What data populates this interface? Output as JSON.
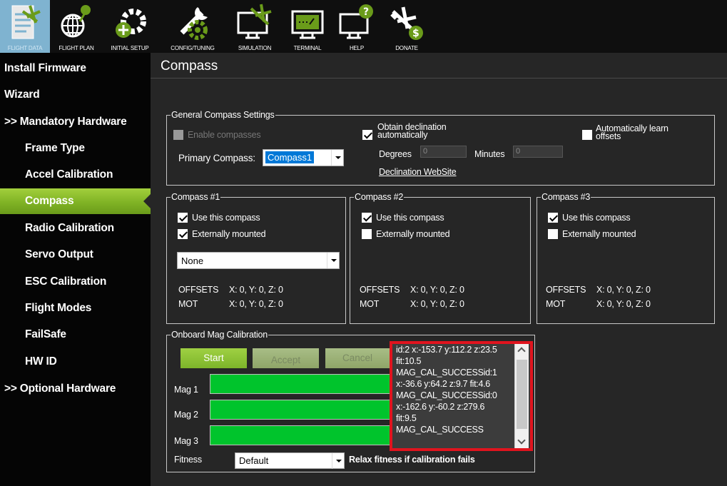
{
  "toolbar": {
    "items": [
      {
        "label": "FLIGHT DATA",
        "icon": "flight-data-icon"
      },
      {
        "label": "FLIGHT PLAN",
        "icon": "flight-plan-icon"
      },
      {
        "label": "INITIAL SETUP",
        "icon": "initial-setup-icon"
      },
      {
        "label": "CONFIG/TUNING",
        "icon": "config-tuning-icon"
      },
      {
        "label": "SIMULATION",
        "icon": "simulation-icon"
      },
      {
        "label": "TERMINAL",
        "icon": "terminal-icon"
      },
      {
        "label": "HELP",
        "icon": "help-icon"
      },
      {
        "label": "DONATE",
        "icon": "donate-icon"
      }
    ]
  },
  "sidebar": {
    "items": [
      {
        "label": "Install Firmware"
      },
      {
        "label": "Wizard"
      },
      {
        "label": ">> Mandatory Hardware"
      },
      {
        "label": "Frame Type"
      },
      {
        "label": "Accel Calibration"
      },
      {
        "label": "Compass"
      },
      {
        "label": "Radio Calibration"
      },
      {
        "label": "Servo Output"
      },
      {
        "label": "ESC Calibration"
      },
      {
        "label": "Flight Modes"
      },
      {
        "label": "FailSafe"
      },
      {
        "label": "HW ID"
      },
      {
        "label": ">> Optional Hardware"
      }
    ]
  },
  "main": {
    "title": "Compass",
    "general": {
      "legend": "General Compass Settings",
      "enable_label": "Enable compasses",
      "primary_label": "Primary Compass:",
      "primary_value": "Compass1",
      "declination_label": "Obtain declination automatically",
      "degrees_label": "Degrees",
      "degrees_value": "0",
      "minutes_label": "Minutes",
      "minutes_value": "0",
      "website_link": "Declination WebSite",
      "learn_label": "Automatically learn offsets"
    },
    "compasses": [
      {
        "legend": "Compass #1",
        "use_label": "Use this compass",
        "ext_label": "Externally mounted",
        "orientation": "None",
        "offsets_label": "OFFSETS",
        "offsets_value": "X: 0,   Y: 0,   Z: 0",
        "mot_label": "MOT",
        "mot_value": "X: 0,   Y: 0,   Z: 0"
      },
      {
        "legend": "Compass #2",
        "use_label": "Use this compass",
        "ext_label": "Externally mounted",
        "offsets_label": "OFFSETS",
        "offsets_value": "X: 0,   Y: 0,   Z: 0",
        "mot_label": "MOT",
        "mot_value": "X: 0,   Y: 0,   Z: 0"
      },
      {
        "legend": "Compass #3",
        "use_label": "Use this compass",
        "ext_label": "Externally mounted",
        "offsets_label": "OFFSETS",
        "offsets_value": "X: 0,   Y: 0,   Z: 0",
        "mot_label": "MOT",
        "mot_value": "X: 0,   Y: 0,   Z: 0"
      }
    ],
    "onboard": {
      "legend": "Onboard Mag Calibration",
      "start_label": "Start",
      "accept_label": "Accept",
      "cancel_label": "Cancel",
      "mag1_label": "Mag 1",
      "mag2_label": "Mag 2",
      "mag3_label": "Mag 3",
      "fitness_label": "Fitness",
      "fitness_value": "Default",
      "relax_label": "Relax fitness if calibration fails",
      "log_lines": [
        "id:2 x:-153.7 y:112.2 z:23.5",
        "fit:10.5",
        "MAG_CAL_SUCCESSid:1",
        "x:-36.6 y:64.2 z:9.7 fit:4.6",
        "MAG_CAL_SUCCESSid:0",
        "x:-162.6 y:-60.2 z:279.6",
        "fit:9.5",
        "MAG_CAL_SUCCESS"
      ]
    }
  },
  "colors": {
    "accent_green": "#80b325",
    "highlight_red": "#e0141e",
    "selection_blue": "#0078d7"
  }
}
